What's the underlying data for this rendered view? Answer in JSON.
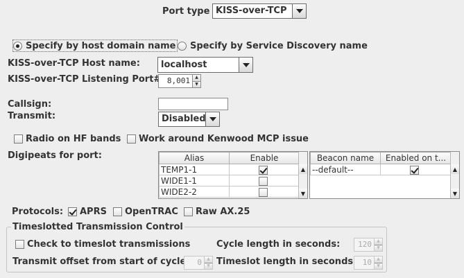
{
  "port_type": {
    "label": "Port type",
    "value": "KISS-over-TCP"
  },
  "host_mode": {
    "option_host": "Specify by host domain name",
    "option_service": "Specify by Service Discovery name"
  },
  "host": {
    "label": "KISS-over-TCP Host name:",
    "value": "localhost"
  },
  "listen_port": {
    "label": "KISS-over-TCP Listening Port#:",
    "value": "8,001"
  },
  "callsign": {
    "label": "Callsign:",
    "value": ""
  },
  "transmit": {
    "label": "Transmit:",
    "value": "Disabled"
  },
  "options": {
    "radio_hf": {
      "label": "Radio on HF bands",
      "checked": false
    },
    "kenwood": {
      "label": "Work around Kenwood MCP issue",
      "checked": false
    }
  },
  "digipeats": {
    "label": "Digipeats for port:",
    "columns": [
      "Alias",
      "Enable"
    ],
    "rows": [
      {
        "alias": "TEMP1-1",
        "enabled": true
      },
      {
        "alias": "WIDE1-1",
        "enabled": false
      },
      {
        "alias": "WIDE2-2",
        "enabled": false
      }
    ]
  },
  "beacons": {
    "columns": [
      "Beacon name",
      "Enabled on t..."
    ],
    "rows": [
      {
        "name": "--default--",
        "enabled": true
      }
    ]
  },
  "protocols": {
    "label": "Protocols:",
    "aprs": {
      "label": "APRS",
      "checked": true
    },
    "opentrac": {
      "label": "OpenTRAC",
      "checked": false
    },
    "raw_ax25": {
      "label": "Raw AX.25",
      "checked": false
    }
  },
  "timeslot": {
    "legend": "Timeslotted Transmission Control",
    "check_label": "Check to timeslot transmissions",
    "cycle_label": "Cycle length in seconds:",
    "cycle_value": "120",
    "offset_label": "Transmit offset from start of cycle:",
    "offset_value": "0",
    "slot_label": "Timeslot length in seconds:",
    "slot_value": "10"
  }
}
